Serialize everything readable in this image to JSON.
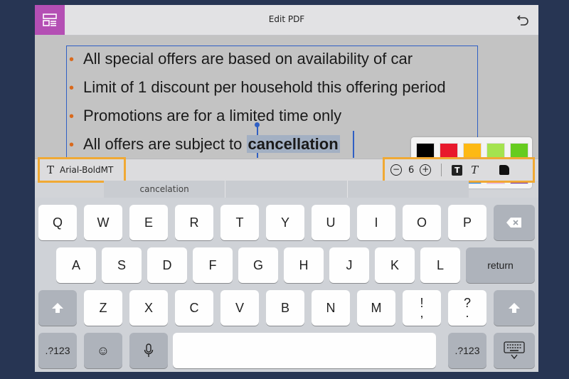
{
  "toolbar": {
    "title": "Edit PDF",
    "app_icon": "layout-icon",
    "undo_icon": "undo-icon"
  },
  "document": {
    "bullets": [
      {
        "text": "All special offers are based on availability of car"
      },
      {
        "text": "Limit of 1 discount per household this offering period"
      },
      {
        "text": "Promotions are for a limited time only"
      },
      {
        "text": "All offers are subject to ",
        "selected": "cancellation"
      }
    ],
    "bullet_color": "#d9691c"
  },
  "palette": {
    "colors": [
      "#000000",
      "#e8192c",
      "#fdb913",
      "#a4e34f",
      "#66cc1f",
      "#ffffff",
      "#30cff5",
      "#1585f7",
      "#f9a5e3",
      "#7733aa"
    ]
  },
  "format": {
    "font_name": "Arial-BoldMT",
    "font_size": "6",
    "minus": "−",
    "plus": "+",
    "bold_label": "T",
    "italic_label": "T"
  },
  "suggestions": [
    "cancelation",
    "",
    ""
  ],
  "keyboard": {
    "row1": [
      "Q",
      "W",
      "E",
      "R",
      "T",
      "Y",
      "U",
      "I",
      "O",
      "P"
    ],
    "row2": [
      "A",
      "S",
      "D",
      "F",
      "G",
      "H",
      "J",
      "K",
      "L"
    ],
    "row3": [
      "Z",
      "X",
      "C",
      "V",
      "B",
      "N",
      "M"
    ],
    "exclam": [
      "!",
      ","
    ],
    "question": [
      "?",
      "."
    ],
    "return_label": "return",
    "numbers_label": ".?123",
    "emoji": "☺",
    "accent_color": "#f0a934"
  }
}
